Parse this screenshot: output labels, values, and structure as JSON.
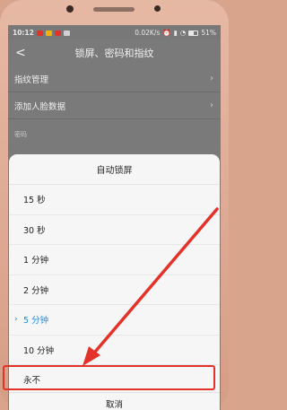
{
  "status_bar": {
    "time": "10:12",
    "net_speed": "0.02K/s",
    "battery": "51%"
  },
  "header": {
    "back_label": "<",
    "title": "锁屏、密码和指纹"
  },
  "settings": {
    "rows": [
      {
        "label": "指纹管理"
      },
      {
        "label": "添加人脸数据"
      }
    ],
    "section_label": "密码"
  },
  "dialog": {
    "title": "自动锁屏",
    "options": [
      {
        "label": "15 秒",
        "selected": false
      },
      {
        "label": "30 秒",
        "selected": false
      },
      {
        "label": "1 分钟",
        "selected": false
      },
      {
        "label": "2 分钟",
        "selected": false
      },
      {
        "label": "5 分钟",
        "selected": true
      },
      {
        "label": "10 分钟",
        "selected": false
      },
      {
        "label": "永不",
        "selected": false
      }
    ],
    "cancel_label": "取消"
  },
  "colors": {
    "accent": "#1c8ee0",
    "annotation_red": "#e3322a"
  }
}
